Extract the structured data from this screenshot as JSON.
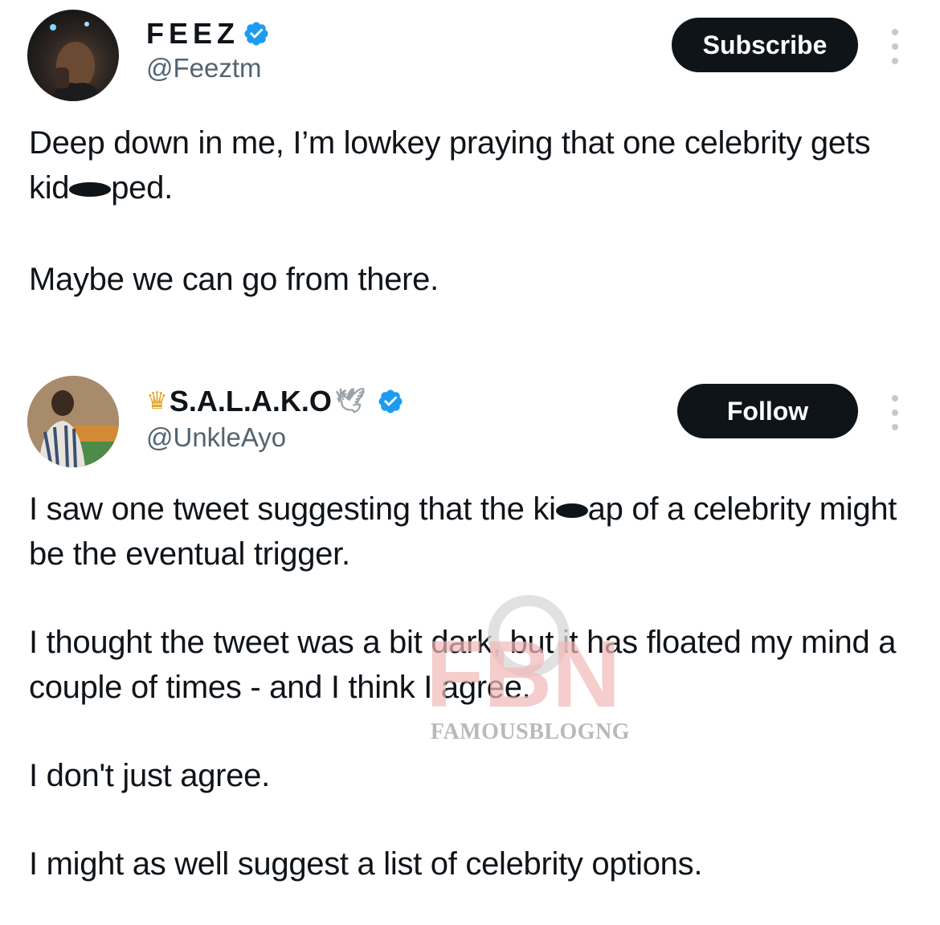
{
  "tweets": [
    {
      "display_name": "FEEZ",
      "handle": "@Feeztm",
      "button_label": "Subscribe",
      "verified": true,
      "text": {
        "p1_a": "Deep down in me, I’m lowkey praying that one celebrity gets kid",
        "p1_b": "ped.",
        "p2": "Maybe we can go from there."
      }
    },
    {
      "display_name": "S.A.L.A.K.O",
      "name_prefix_emoji": "👑",
      "name_suffix_emoji": "🕊",
      "handle": "@UnkleAyo",
      "button_label": "Follow",
      "verified": true,
      "text": {
        "p1_a": "I saw one tweet suggesting that the ki",
        "p1_b": "ap of a celebrity might be the eventual trigger.",
        "p2": "I thought the tweet was a bit dark, but it has floated my mind a couple of times - and I think I agree.",
        "p3": "I don't just agree.",
        "p4": "I might as well suggest a list of celebrity options."
      }
    }
  ],
  "watermark": {
    "text": "FAMOUSBLOGNG",
    "logo_letters": "FBN"
  },
  "colors": {
    "text": "#0f1419",
    "secondary": "#536471",
    "verified_blue": "#1d9bf0",
    "button_bg": "#0f1419"
  }
}
